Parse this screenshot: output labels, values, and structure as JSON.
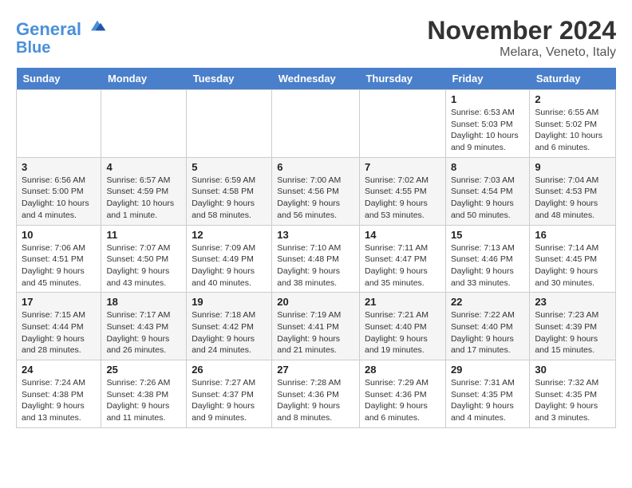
{
  "header": {
    "logo_line1": "General",
    "logo_line2": "Blue",
    "month_title": "November 2024",
    "location": "Melara, Veneto, Italy"
  },
  "days_of_week": [
    "Sunday",
    "Monday",
    "Tuesday",
    "Wednesday",
    "Thursday",
    "Friday",
    "Saturday"
  ],
  "weeks": [
    [
      {
        "day": "",
        "info": ""
      },
      {
        "day": "",
        "info": ""
      },
      {
        "day": "",
        "info": ""
      },
      {
        "day": "",
        "info": ""
      },
      {
        "day": "",
        "info": ""
      },
      {
        "day": "1",
        "info": "Sunrise: 6:53 AM\nSunset: 5:03 PM\nDaylight: 10 hours and 9 minutes."
      },
      {
        "day": "2",
        "info": "Sunrise: 6:55 AM\nSunset: 5:02 PM\nDaylight: 10 hours and 6 minutes."
      }
    ],
    [
      {
        "day": "3",
        "info": "Sunrise: 6:56 AM\nSunset: 5:00 PM\nDaylight: 10 hours and 4 minutes."
      },
      {
        "day": "4",
        "info": "Sunrise: 6:57 AM\nSunset: 4:59 PM\nDaylight: 10 hours and 1 minute."
      },
      {
        "day": "5",
        "info": "Sunrise: 6:59 AM\nSunset: 4:58 PM\nDaylight: 9 hours and 58 minutes."
      },
      {
        "day": "6",
        "info": "Sunrise: 7:00 AM\nSunset: 4:56 PM\nDaylight: 9 hours and 56 minutes."
      },
      {
        "day": "7",
        "info": "Sunrise: 7:02 AM\nSunset: 4:55 PM\nDaylight: 9 hours and 53 minutes."
      },
      {
        "day": "8",
        "info": "Sunrise: 7:03 AM\nSunset: 4:54 PM\nDaylight: 9 hours and 50 minutes."
      },
      {
        "day": "9",
        "info": "Sunrise: 7:04 AM\nSunset: 4:53 PM\nDaylight: 9 hours and 48 minutes."
      }
    ],
    [
      {
        "day": "10",
        "info": "Sunrise: 7:06 AM\nSunset: 4:51 PM\nDaylight: 9 hours and 45 minutes."
      },
      {
        "day": "11",
        "info": "Sunrise: 7:07 AM\nSunset: 4:50 PM\nDaylight: 9 hours and 43 minutes."
      },
      {
        "day": "12",
        "info": "Sunrise: 7:09 AM\nSunset: 4:49 PM\nDaylight: 9 hours and 40 minutes."
      },
      {
        "day": "13",
        "info": "Sunrise: 7:10 AM\nSunset: 4:48 PM\nDaylight: 9 hours and 38 minutes."
      },
      {
        "day": "14",
        "info": "Sunrise: 7:11 AM\nSunset: 4:47 PM\nDaylight: 9 hours and 35 minutes."
      },
      {
        "day": "15",
        "info": "Sunrise: 7:13 AM\nSunset: 4:46 PM\nDaylight: 9 hours and 33 minutes."
      },
      {
        "day": "16",
        "info": "Sunrise: 7:14 AM\nSunset: 4:45 PM\nDaylight: 9 hours and 30 minutes."
      }
    ],
    [
      {
        "day": "17",
        "info": "Sunrise: 7:15 AM\nSunset: 4:44 PM\nDaylight: 9 hours and 28 minutes."
      },
      {
        "day": "18",
        "info": "Sunrise: 7:17 AM\nSunset: 4:43 PM\nDaylight: 9 hours and 26 minutes."
      },
      {
        "day": "19",
        "info": "Sunrise: 7:18 AM\nSunset: 4:42 PM\nDaylight: 9 hours and 24 minutes."
      },
      {
        "day": "20",
        "info": "Sunrise: 7:19 AM\nSunset: 4:41 PM\nDaylight: 9 hours and 21 minutes."
      },
      {
        "day": "21",
        "info": "Sunrise: 7:21 AM\nSunset: 4:40 PM\nDaylight: 9 hours and 19 minutes."
      },
      {
        "day": "22",
        "info": "Sunrise: 7:22 AM\nSunset: 4:40 PM\nDaylight: 9 hours and 17 minutes."
      },
      {
        "day": "23",
        "info": "Sunrise: 7:23 AM\nSunset: 4:39 PM\nDaylight: 9 hours and 15 minutes."
      }
    ],
    [
      {
        "day": "24",
        "info": "Sunrise: 7:24 AM\nSunset: 4:38 PM\nDaylight: 9 hours and 13 minutes."
      },
      {
        "day": "25",
        "info": "Sunrise: 7:26 AM\nSunset: 4:38 PM\nDaylight: 9 hours and 11 minutes."
      },
      {
        "day": "26",
        "info": "Sunrise: 7:27 AM\nSunset: 4:37 PM\nDaylight: 9 hours and 9 minutes."
      },
      {
        "day": "27",
        "info": "Sunrise: 7:28 AM\nSunset: 4:36 PM\nDaylight: 9 hours and 8 minutes."
      },
      {
        "day": "28",
        "info": "Sunrise: 7:29 AM\nSunset: 4:36 PM\nDaylight: 9 hours and 6 minutes."
      },
      {
        "day": "29",
        "info": "Sunrise: 7:31 AM\nSunset: 4:35 PM\nDaylight: 9 hours and 4 minutes."
      },
      {
        "day": "30",
        "info": "Sunrise: 7:32 AM\nSunset: 4:35 PM\nDaylight: 9 hours and 3 minutes."
      }
    ]
  ]
}
